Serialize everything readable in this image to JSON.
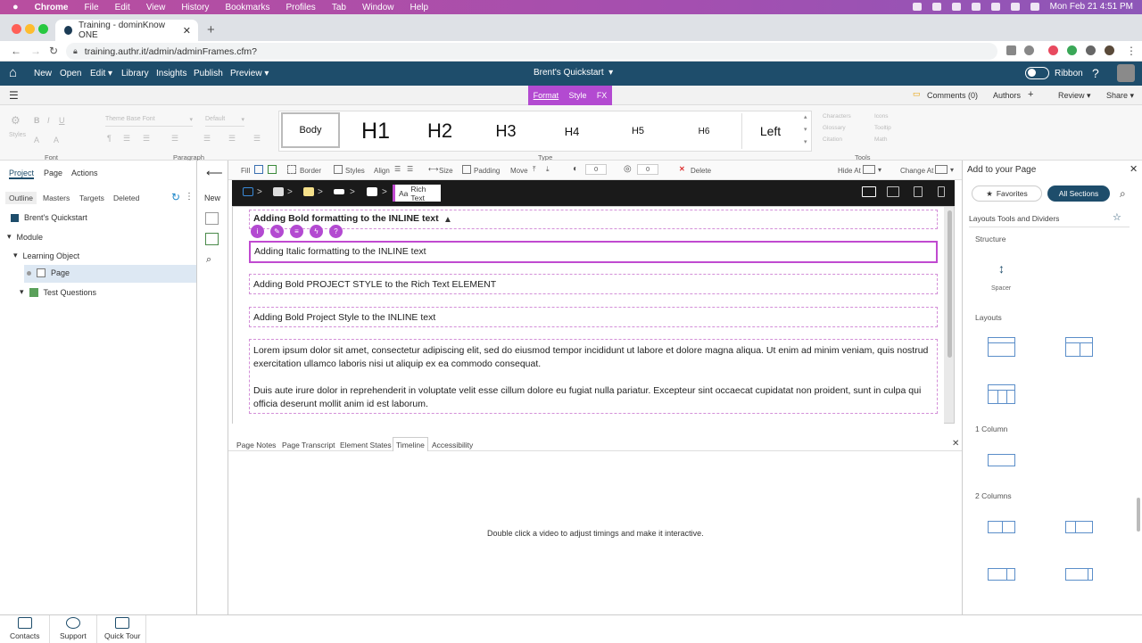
{
  "mac_menubar": {
    "apple": "",
    "app": "Chrome",
    "items": [
      "File",
      "Edit",
      "View",
      "History",
      "Bookmarks",
      "Profiles",
      "Tab",
      "Window",
      "Help"
    ],
    "datetime": "Mon Feb 21  4:51 PM"
  },
  "browser": {
    "tab_title": "Training - dominKnow ONE",
    "url": "training.authr.it/admin/adminFrames.cfm?"
  },
  "appbar": {
    "menu": [
      "New",
      "Open",
      "Edit",
      "Library",
      "Insights",
      "Publish",
      "Preview"
    ],
    "project_title": "Brent's Quickstart",
    "ribbon_label": "Ribbon",
    "help": "?"
  },
  "ribbon_tabs": {
    "tabs": [
      "Format",
      "Style",
      "FX"
    ],
    "comments": "Comments (0)",
    "authors": "Authors",
    "review": "Review",
    "share": "Share"
  },
  "ribbon": {
    "styles_label": "Styles",
    "font_placeholder": "Theme Base Font",
    "size_placeholder": "Default",
    "group_font": "Font",
    "group_paragraph": "Paragraph",
    "group_type": "Type",
    "group_tools": "Tools",
    "type_styles": [
      "Body",
      "H1",
      "H2",
      "H3",
      "H4",
      "H5",
      "H6",
      "Left"
    ],
    "tools": [
      "Characters",
      "Icons",
      "Glossary",
      "Tooltip",
      "Citation",
      "Math"
    ]
  },
  "left_panel": {
    "tabs": [
      "Project",
      "Page",
      "Actions"
    ],
    "subtabs": [
      "Outline",
      "Masters",
      "Targets",
      "Deleted"
    ],
    "tree": [
      {
        "label": "Brent's Quickstart"
      },
      {
        "label": "Module"
      },
      {
        "label": "Learning Object"
      },
      {
        "label": "Page"
      },
      {
        "label": "Test Questions"
      }
    ],
    "new_label": "New"
  },
  "editor_toolbar": {
    "items": [
      "Fill",
      "Border",
      "Styles",
      "Align",
      "Size",
      "Padding",
      "Move",
      "Delete",
      "Hide At",
      "Change At"
    ],
    "val1": "0",
    "val2": "0"
  },
  "breadcrumb": {
    "rich_text": "Rich Text"
  },
  "content_blocks": [
    "Adding Bold formatting to the INLINE text",
    "Adding Italic formatting to the INLINE text",
    "Adding Bold PROJECT STYLE to the Rich Text ELEMENT",
    "Adding Bold Project Style to the INLINE text",
    "Lorem ipsum dolor sit amet, consectetur adipiscing elit, sed do eiusmod tempor incididunt ut labore et dolore magna aliqua. Ut enim ad minim veniam, quis nostrud exercitation ullamco laboris nisi ut aliquip ex ea commodo consequat.",
    "Duis aute irure dolor in reprehenderit in voluptate velit esse cillum dolore eu fugiat nulla pariatur. Excepteur sint occaecat cupidatat non proident, sunt in culpa qui officia deserunt mollit anim id est laborum."
  ],
  "bottom_tabs": [
    "Page Notes",
    "Page Transcript",
    "Element States",
    "Timeline",
    "Accessibility"
  ],
  "timeline_message": "Double click a video to adjust timings and make it interactive.",
  "right_panel": {
    "title": "Add to your Page",
    "favorites": "Favorites",
    "all_sections": "All Sections",
    "category": "Layouts Tools and Dividers",
    "sections": [
      "Structure",
      "Layouts",
      "1 Column",
      "2 Columns"
    ],
    "spacer": "Spacer"
  },
  "footer": [
    "Contacts",
    "Support",
    "Quick Tour"
  ],
  "colors": {
    "accent": "#b34ad1",
    "appbar": "#1e4d6b",
    "layout_icon": "#5b8ec9"
  }
}
